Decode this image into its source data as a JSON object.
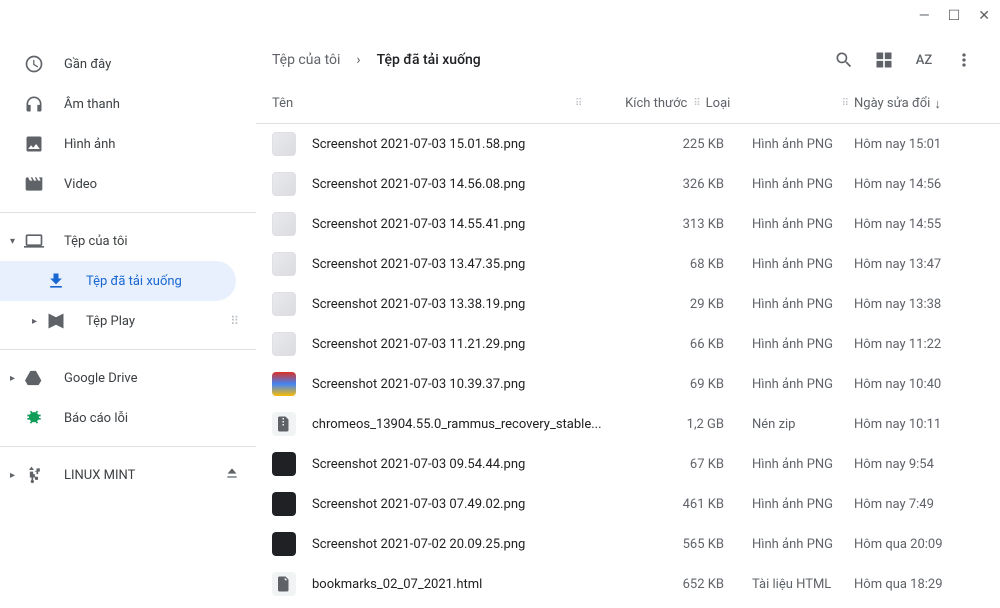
{
  "sidebar": {
    "recent": "Gần đây",
    "audio": "Âm thanh",
    "images": "Hình ảnh",
    "video": "Video",
    "myfiles": "Tệp của tôi",
    "downloads": "Tệp đã tải xuống",
    "playfiles": "Tệp Play",
    "drive": "Google Drive",
    "bugreport": "Báo cáo lỗi",
    "linux": "LINUX MINT"
  },
  "breadcrumb": {
    "parent": "Tệp của tôi",
    "current": "Tệp đã tải xuống"
  },
  "columns": {
    "name": "Tên",
    "size": "Kích thước",
    "type": "Loại",
    "date": "Ngày sửa đổi"
  },
  "files": [
    {
      "name": "Screenshot 2021-07-03 15.01.58.png",
      "size": "225 KB",
      "type": "Hình ảnh PNG",
      "date": "Hôm nay 15:01",
      "icon": "thumb"
    },
    {
      "name": "Screenshot 2021-07-03 14.56.08.png",
      "size": "326 KB",
      "type": "Hình ảnh PNG",
      "date": "Hôm nay 14:56",
      "icon": "thumb"
    },
    {
      "name": "Screenshot 2021-07-03 14.55.41.png",
      "size": "313 KB",
      "type": "Hình ảnh PNG",
      "date": "Hôm nay 14:55",
      "icon": "thumb"
    },
    {
      "name": "Screenshot 2021-07-03 13.47.35.png",
      "size": "68 KB",
      "type": "Hình ảnh PNG",
      "date": "Hôm nay 13:47",
      "icon": "thumb"
    },
    {
      "name": "Screenshot 2021-07-03 13.38.19.png",
      "size": "29 KB",
      "type": "Hình ảnh PNG",
      "date": "Hôm nay 13:38",
      "icon": "thumb"
    },
    {
      "name": "Screenshot 2021-07-03 11.21.29.png",
      "size": "66 KB",
      "type": "Hình ảnh PNG",
      "date": "Hôm nay 11:22",
      "icon": "thumb"
    },
    {
      "name": "Screenshot 2021-07-03 10.39.37.png",
      "size": "69 KB",
      "type": "Hình ảnh PNG",
      "date": "Hôm nay 10:40",
      "icon": "grad"
    },
    {
      "name": "chromeos_13904.55.0_rammus_recovery_stable...",
      "size": "1,2 GB",
      "type": "Nén zip",
      "date": "Hôm nay 10:11",
      "icon": "zip"
    },
    {
      "name": "Screenshot 2021-07-03 09.54.44.png",
      "size": "67 KB",
      "type": "Hình ảnh PNG",
      "date": "Hôm nay 9:54",
      "icon": "dark"
    },
    {
      "name": "Screenshot 2021-07-03 07.49.02.png",
      "size": "461 KB",
      "type": "Hình ảnh PNG",
      "date": "Hôm nay 7:49",
      "icon": "dark"
    },
    {
      "name": "Screenshot 2021-07-02 20.09.25.png",
      "size": "565 KB",
      "type": "Hình ảnh PNG",
      "date": "Hôm qua 20:09",
      "icon": "dark"
    },
    {
      "name": "bookmarks_02_07_2021.html",
      "size": "652 KB",
      "type": "Tài liệu HTML",
      "date": "Hôm qua 18:29",
      "icon": "file"
    }
  ]
}
